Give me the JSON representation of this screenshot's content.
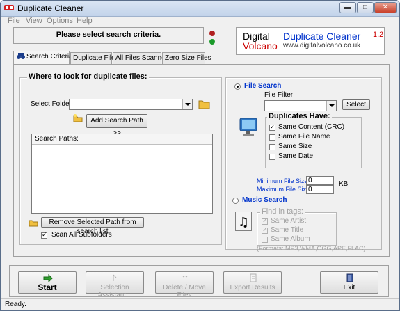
{
  "window": {
    "title": "Duplicate Cleaner",
    "min_label": "▬",
    "max_label": "□",
    "close_label": "✕"
  },
  "menu": [
    "File",
    "View",
    "Options",
    "Help"
  ],
  "header": {
    "instruction": "Please select search criteria."
  },
  "logo": {
    "digital": "Digital",
    "volcano": "Volcano",
    "title": "Duplicate Cleaner",
    "version": "1.2",
    "url": "www.digitalvolcano.co.uk"
  },
  "tabs": [
    "Search Criteria",
    "Duplicate Files",
    "All Files Scanned",
    "Zero Size Files"
  ],
  "left": {
    "group_title": "Where to look for duplicate files:",
    "select_folder_label": "Select Folder:",
    "folder_value": "",
    "add_path_button": "Add Search Path >>",
    "search_paths_header": "Search Paths:",
    "remove_path_button": "Remove Selected Path from search list",
    "scan_subfolders_label": "Scan All Subfolders",
    "scan_subfolders_checked": true
  },
  "right": {
    "file_search_label": "File Search",
    "file_search_selected": true,
    "file_filter_label": "File Filter:",
    "file_filter_value": "",
    "select_button": "Select",
    "duplicates_title": "Duplicates Have:",
    "duplicates": [
      {
        "label": "Same Content (CRC)",
        "checked": true
      },
      {
        "label": "Same File Name",
        "checked": false
      },
      {
        "label": "Same Size",
        "checked": false
      },
      {
        "label": "Same Date",
        "checked": false
      }
    ],
    "min_size_label": "Minimum File Size",
    "min_size_value": "0",
    "max_size_label": "Maximum File Size",
    "max_size_value": "0",
    "size_unit": "KB",
    "music_search_label": "Music Search",
    "music_search_selected": false,
    "tags_title": "Find in tags:",
    "tags": [
      {
        "label": "Same Artist",
        "checked": true
      },
      {
        "label": "Same Title",
        "checked": true
      },
      {
        "label": "Same Album",
        "checked": false
      }
    ],
    "formats": "(Formats: MP3,WMA,OGG,APE,FLAC)"
  },
  "bottom": {
    "start": "Start",
    "selection_assistant": "Selection Assistant...",
    "delete_move": "Delete / Move Files",
    "export": "Export Results",
    "exit": "Exit"
  },
  "status": "Ready.",
  "colors": {
    "accent_blue": "#0033cc",
    "logo_red": "#cc0000",
    "disabled_text": "#a0a0a0"
  }
}
